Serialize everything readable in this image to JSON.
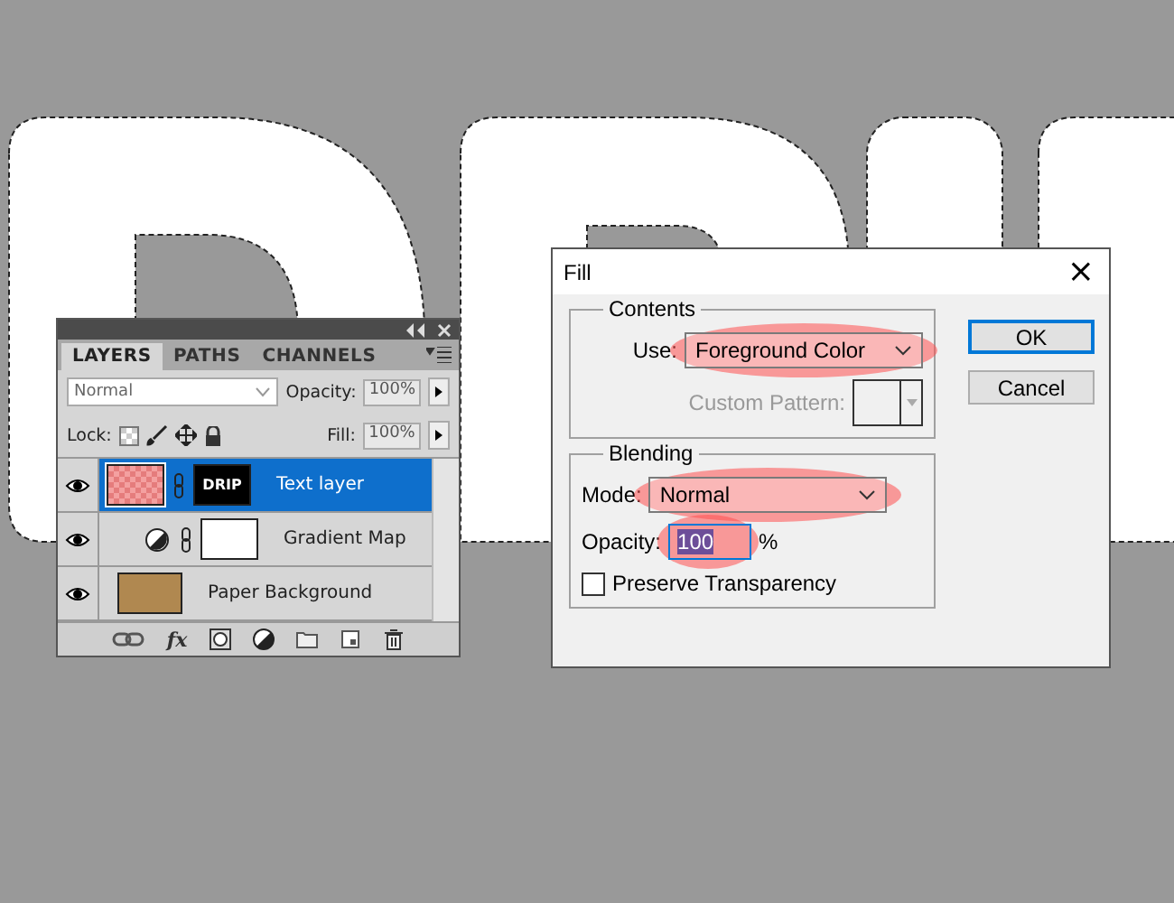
{
  "layers_panel": {
    "fx_label": "fx",
    "tabs": [
      {
        "label": "LAYERS",
        "selected": true
      },
      {
        "label": "PATHS",
        "selected": false
      },
      {
        "label": "CHANNELS",
        "selected": false
      }
    ],
    "blend_mode": "Normal",
    "opacity_label": "Opacity:",
    "opacity": "100%",
    "lock_label": "Lock:",
    "fill_label": "Fill:",
    "fill": "100%",
    "layers": [
      {
        "kind": "text",
        "name": "Text layer",
        "thumb_text": "DRIP",
        "visible": true,
        "selected": true
      },
      {
        "kind": "adjustment",
        "name": "Gradient Map",
        "visible": true,
        "selected": false
      },
      {
        "kind": "image",
        "name": "Paper Background",
        "visible": true,
        "selected": false
      }
    ]
  },
  "fill_dialog": {
    "title": "Fill",
    "close": "×",
    "contents": {
      "legend": "Contents",
      "use_label": "Use:",
      "use": "Foreground Color",
      "use_highlighted": true,
      "custom_pattern_label": "Custom Pattern:"
    },
    "blending": {
      "legend": "Blending",
      "mode_label": "Mode:",
      "mode": "Normal",
      "mode_highlighted": true,
      "opacity_label": "Opacity:",
      "opacity": "100",
      "opacity_highlighted": true,
      "percent": "%",
      "preserve_label": "Preserve Transparency",
      "preserve_checked": false
    },
    "buttons": [
      "OK",
      "Cancel"
    ]
  }
}
